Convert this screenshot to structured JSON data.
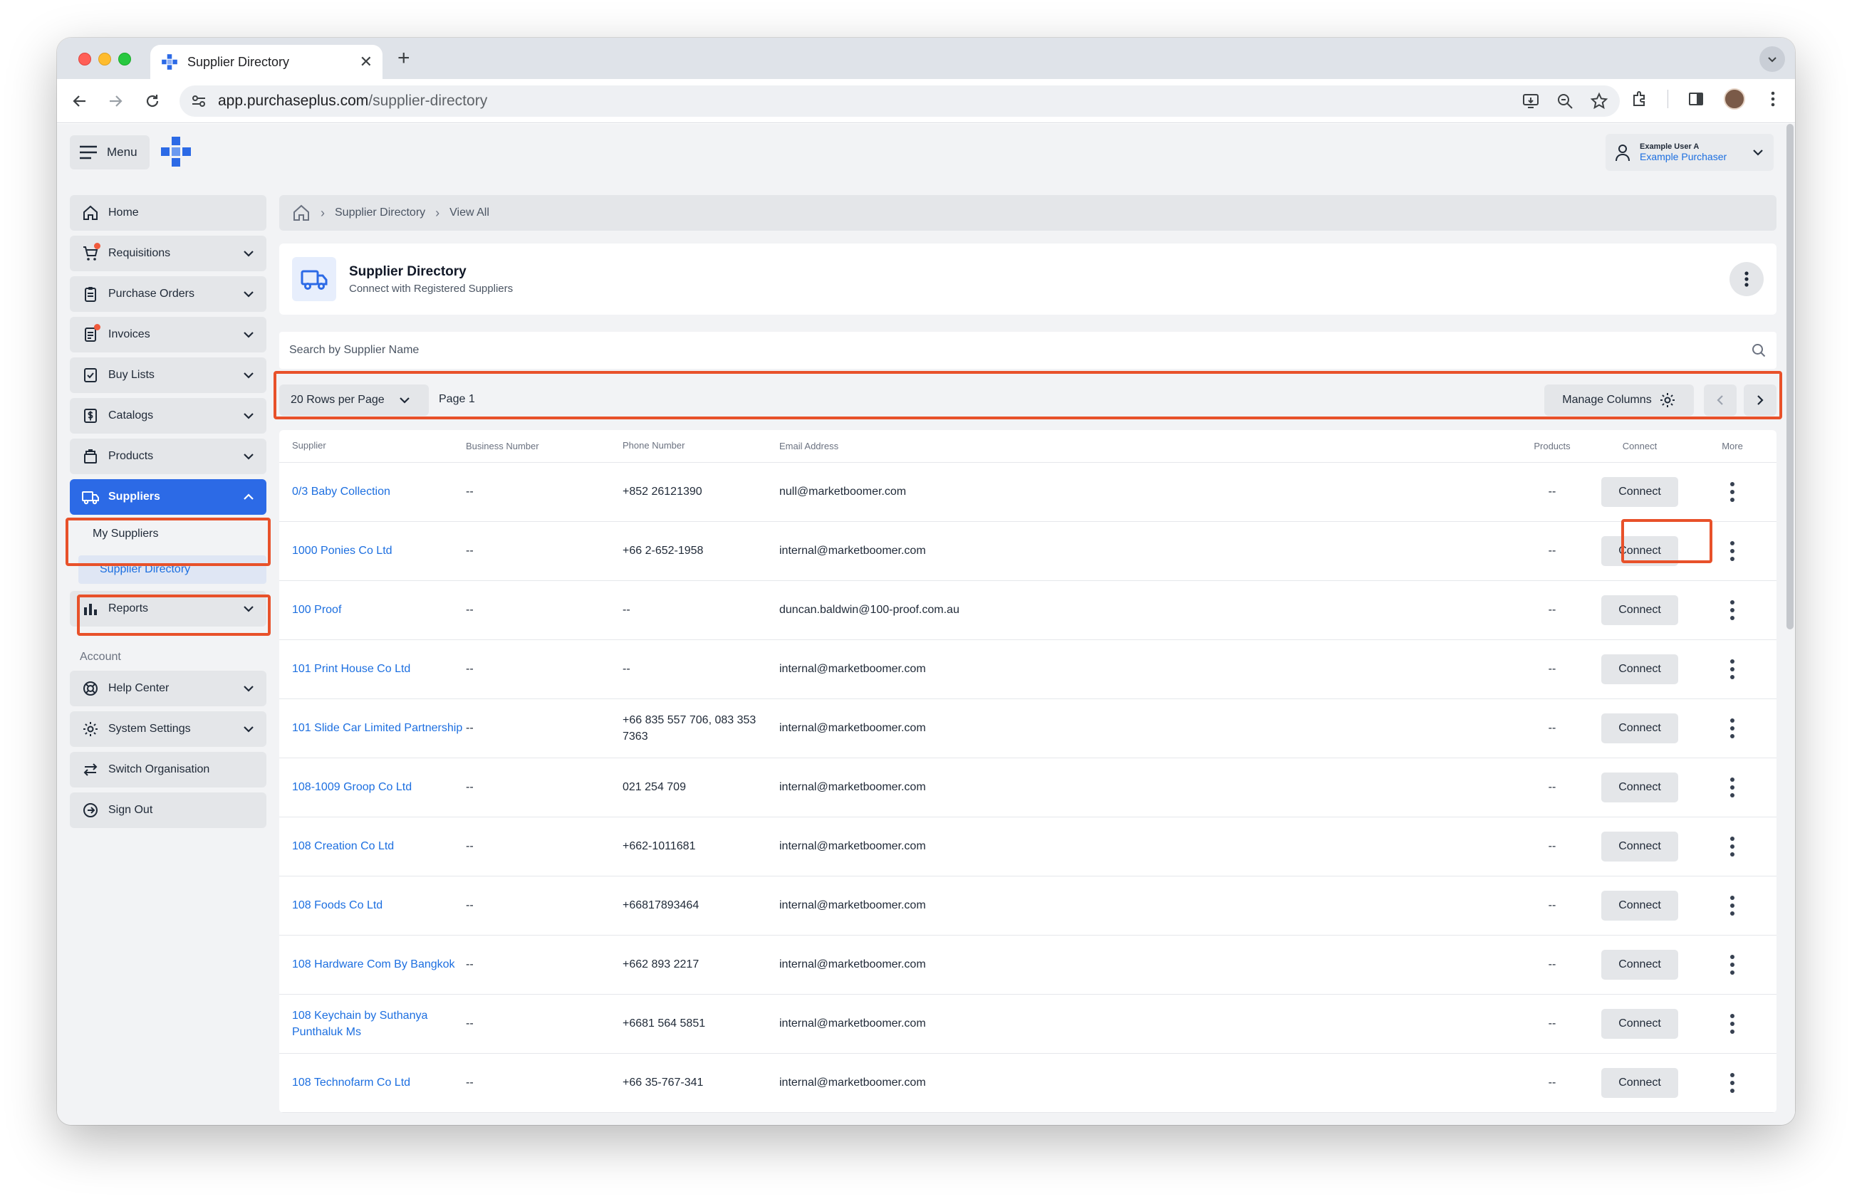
{
  "browser": {
    "tab_title": "Supplier Directory",
    "url_host": "app.purchaseplus.com",
    "url_path": "/supplier-directory"
  },
  "header": {
    "menu_label": "Menu",
    "user_name": "Example User A",
    "user_role": "Example Purchaser"
  },
  "sidebar": {
    "items": [
      {
        "label": "Home",
        "icon": "home-icon"
      },
      {
        "label": "Requisitions",
        "icon": "cart-icon"
      },
      {
        "label": "Purchase Orders",
        "icon": "clipboard-icon"
      },
      {
        "label": "Invoices",
        "icon": "invoice-icon"
      },
      {
        "label": "Buy Lists",
        "icon": "checklist-icon"
      },
      {
        "label": "Catalogs",
        "icon": "dollar-doc-icon"
      },
      {
        "label": "Products",
        "icon": "box-icon"
      },
      {
        "label": "Suppliers",
        "icon": "truck-icon"
      },
      {
        "label": "Reports",
        "icon": "bar-chart-icon"
      }
    ],
    "sub_items": [
      "My Suppliers",
      "Supplier Directory"
    ],
    "account_label": "Account",
    "account_items": [
      {
        "label": "Help Center",
        "icon": "lifebuoy-icon"
      },
      {
        "label": "System Settings",
        "icon": "gear-icon"
      },
      {
        "label": "Switch Organisation",
        "icon": "swap-icon"
      },
      {
        "label": "Sign Out",
        "icon": "sign-out-icon"
      }
    ]
  },
  "breadcrumb": {
    "items": [
      "Supplier Directory",
      "View All"
    ]
  },
  "page": {
    "title": "Supplier Directory",
    "subtitle": "Connect with Registered Suppliers"
  },
  "search": {
    "placeholder": "Search by Supplier Name"
  },
  "controls": {
    "rows_per_page": "20 Rows per Page",
    "page_label": "Page 1",
    "manage_columns": "Manage Columns"
  },
  "table": {
    "columns": [
      "Supplier",
      "Business Number",
      "Phone Number",
      "Email Address",
      "Products",
      "Connect",
      "More"
    ],
    "connect_label": "Connect",
    "rows": [
      {
        "supplier": "0/3 Baby Collection",
        "business_number": "--",
        "phone": "+852 26121390",
        "email": "null@marketboomer.com",
        "products": "--"
      },
      {
        "supplier": "1000 Ponies Co Ltd",
        "business_number": "--",
        "phone": "+66 2-652-1958",
        "email": "internal@marketboomer.com",
        "products": "--"
      },
      {
        "supplier": "100 Proof",
        "business_number": "--",
        "phone": "--",
        "email": "duncan.baldwin@100-proof.com.au",
        "products": "--"
      },
      {
        "supplier": "101 Print House Co Ltd",
        "business_number": "--",
        "phone": "--",
        "email": "internal@marketboomer.com",
        "products": "--"
      },
      {
        "supplier": "101 Slide Car Limited Partnership",
        "business_number": "--",
        "phone": "+66 835 557 706, 083 353 7363",
        "email": "internal@marketboomer.com",
        "products": "--"
      },
      {
        "supplier": "108-1009 Groop Co Ltd",
        "business_number": "--",
        "phone": "021 254 709",
        "email": "internal@marketboomer.com",
        "products": "--"
      },
      {
        "supplier": "108 Creation Co Ltd",
        "business_number": "--",
        "phone": "+662-1011681",
        "email": "internal@marketboomer.com",
        "products": "--"
      },
      {
        "supplier": "108 Foods Co Ltd",
        "business_number": "--",
        "phone": "+66817893464",
        "email": "internal@marketboomer.com",
        "products": "--"
      },
      {
        "supplier": "108 Hardware Com By Bangkok",
        "business_number": "--",
        "phone": "+662 893 2217",
        "email": "internal@marketboomer.com",
        "products": "--"
      },
      {
        "supplier": "108 Keychain by Suthanya Punthaluk Ms",
        "business_number": "--",
        "phone": "+6681 564 5851",
        "email": "internal@marketboomer.com",
        "products": "--"
      },
      {
        "supplier": "108 Technofarm Co Ltd",
        "business_number": "--",
        "phone": "+66 35-767-341",
        "email": "internal@marketboomer.com",
        "products": "--"
      }
    ]
  },
  "colors": {
    "accent": "#2c6ae6",
    "link": "#1d6fe0",
    "highlight": "#e8512a"
  }
}
